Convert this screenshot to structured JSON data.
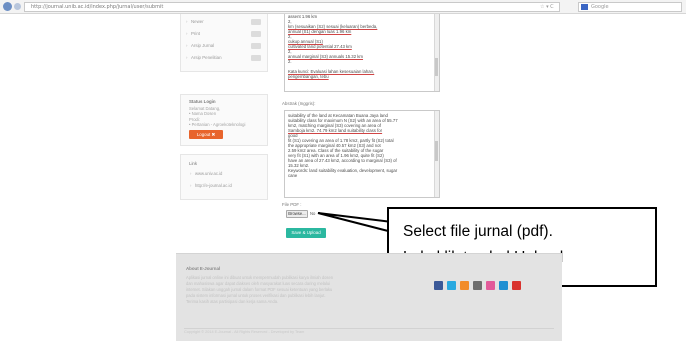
{
  "browser": {
    "address": "http://journal.unib.ac.id/index.php/jurnal/user/submit",
    "address_tail": "☆ ▾ C",
    "search_placeholder": "Google"
  },
  "sidebar": {
    "menu": [
      {
        "label": "Newer"
      },
      {
        "label": "Print"
      },
      {
        "label": "Arsip Jurnal"
      },
      {
        "label": "Arsip Penelitian"
      }
    ],
    "status": {
      "title": "Status Login",
      "lines": [
        "Selamat Datang,",
        "• Nama Dosen",
        "Prodi:",
        "• Pertanian - Agroekoteknologi"
      ],
      "logout_label": "Logout ✖"
    },
    "links": {
      "title": "Link",
      "items": [
        "www.univ.ac.id",
        "http://e-journal.ac.id"
      ]
    }
  },
  "form": {
    "abstract_en_lines": [
      "assent 1.96 km",
      "2,",
      "km (sesuaikan (S2) sesuai (keluaran) berbeda,",
      "annual (S1) dengan luas 1.96 km",
      "2,",
      "cukup annual (S1)",
      "cultivated land potential 27.43 km",
      "2,",
      "annual marginal (S3) annuals 15.32 km",
      "2.",
      "",
      "Kata kunci: Evaluasi lahan kesesuaian lahan,",
      "pengembangan, tebu"
    ],
    "abstract_id_label": "Abstrak (Inggris):",
    "abstract_id_lines": [
      "suitability of the land at Kecamatan Buana Jaya land",
      "suitability class for maximum N (S2) with an area of 55.77",
      "km2, matching marginal (S3) covering an area of",
      "Samboja km2. 74.79 km2 land suitability class for",
      "good",
      "fit (S1) covering an area of 1.78 km2, partly fit (S2) total",
      "the appropriate marginal 40.57 km2 (S3) and not",
      "2.59 km2 area. Class of the suitability of the sugar",
      "very fit (S1) with an area of 1.96 km2, quite fit (S2)",
      "have an area of 27.43 km2, according to marginal (S3) of",
      "15.32 km2.",
      "Keywords: land suitability evaluation, development, sugar",
      "cane"
    ],
    "file_label": "File PDF :",
    "browse_label": "Browse...",
    "file_value": "No",
    "upload_label": "Save & Upload"
  },
  "callout": {
    "line1": "Select file jurnal (pdf).",
    "line2": "Lalu klik tombol Upload"
  },
  "footer": {
    "title": "About E-Journal",
    "text_lines": [
      "Aplikasi jurnal online ini dibuat untuk mempermudah publikasi karya ilmiah dosen",
      "dan mahasiswa agar dapat diakses oleh masyarakat luas secara daring melalui",
      "internet. Silakan unggah jurnal dalam format PDF sesuai ketentuan yang berlaku",
      "pada sistem informasi jurnal untuk proses verifikasi dan publikasi lebih lanjut.",
      "Terima kasih atas partisipasi dan kerja sama Anda."
    ],
    "copyright": "Copyright © 2014 E-Journal - All Rights Reserved - Developed by Team",
    "social": [
      {
        "name": "facebook",
        "color": "#3b5998"
      },
      {
        "name": "twitter",
        "color": "#2aa9e0"
      },
      {
        "name": "rss",
        "color": "#f28c28"
      },
      {
        "name": "email",
        "color": "#6d6d6d"
      },
      {
        "name": "flickr",
        "color": "#e25b9a"
      },
      {
        "name": "linkedin",
        "color": "#1f8fd2"
      },
      {
        "name": "youtube",
        "color": "#d9332e"
      }
    ]
  },
  "colors": {
    "logout": "#e8642c",
    "upload": "#2bb8a0",
    "footer_bg": "#e3e3e3"
  }
}
